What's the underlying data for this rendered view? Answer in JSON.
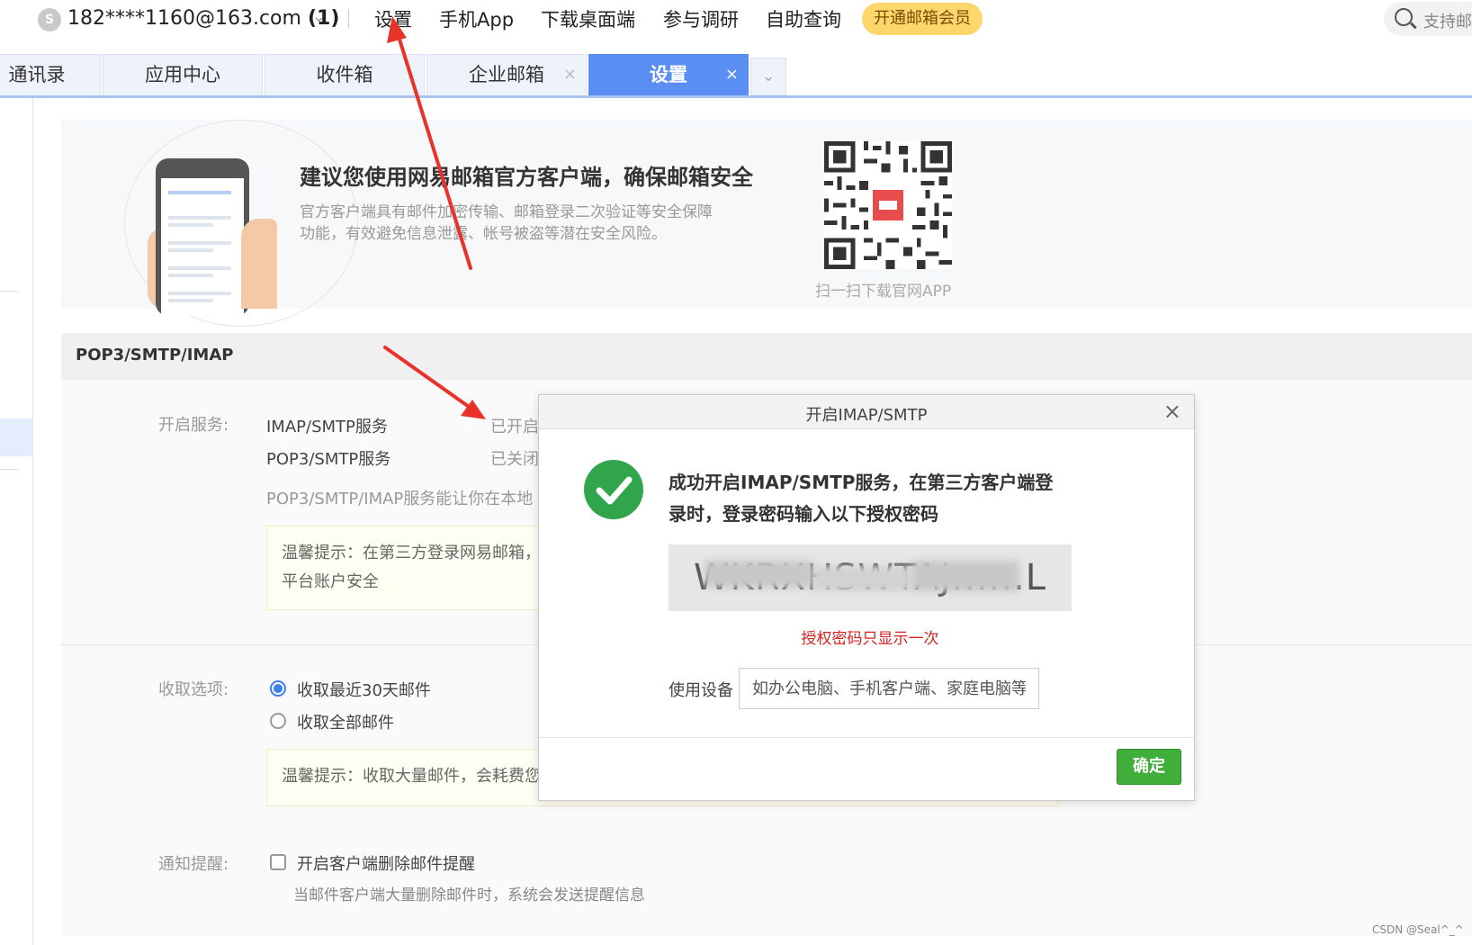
{
  "topbar": {
    "account_icon": "user-avatar-icon",
    "account": "182****1160@163.com",
    "unread": "(1)",
    "links": [
      "设置",
      "手机App",
      "下载桌面端",
      "参与调研",
      "自助查询"
    ],
    "vip_button": "开通邮箱会员",
    "search_placeholder": "支持邮"
  },
  "tabs": {
    "items": [
      {
        "label": "通讯录"
      },
      {
        "label": "应用中心"
      },
      {
        "label": "收件箱"
      },
      {
        "label": "企业邮箱",
        "close": "×"
      },
      {
        "label": "设置",
        "close": "×",
        "active": true
      }
    ],
    "more": "⌄"
  },
  "promo": {
    "title": "建议您使用网易邮箱官方客户端，确保邮箱安全",
    "desc": "官方客户端具有邮件加密传输、邮箱登录二次验证等安全保障功能，有效避免信息泄露、帐号被盗等潜在安全风险。",
    "qr_caption": "扫一扫下载官网APP"
  },
  "section": {
    "title": "POP3/SMTP/IMAP",
    "service_label": "开启服务:",
    "services": [
      {
        "name": "IMAP/SMTP服务",
        "status": "已开启"
      },
      {
        "name": "POP3/SMTP服务",
        "status": "已关闭"
      }
    ],
    "service_desc": "POP3/SMTP/IMAP服务能让你在本地",
    "hint1_line1": "温馨提示：在第三方登录网易邮箱，",
    "hint1_line2": "平台账户安全",
    "fetch_label": "收取选项:",
    "fetch_options": [
      "收取最近30天邮件",
      "收取全部邮件"
    ],
    "hint2": "温馨提示：收取大量邮件，会耗费您",
    "notify_label": "通知提醒:",
    "notify_option": "开启客户端删除邮件提醒",
    "notify_desc": "当邮件客户端大量删除邮件时，系统会发送提醒信息"
  },
  "modal": {
    "title": "开启IMAP/SMTP",
    "close": "×",
    "message_line1": "成功开启IMAP/SMTP服务，在第三方客户端登",
    "message_line2": "录时，登录密码输入以下授权密码",
    "code": "WKRXHSWTAJ......L",
    "code_note": "授权密码只显示一次",
    "device_label": "使用设备",
    "device_placeholder": "如办公电脑、手机客户端、家庭电脑等",
    "confirm": "确定"
  },
  "watermark": "CSDN @Seal^_^",
  "colors": {
    "accent": "#5b8ef2",
    "success": "#30a54b",
    "warning_text": "#d42020",
    "vip": "#ffd66b",
    "arrow": "#e8322a"
  }
}
